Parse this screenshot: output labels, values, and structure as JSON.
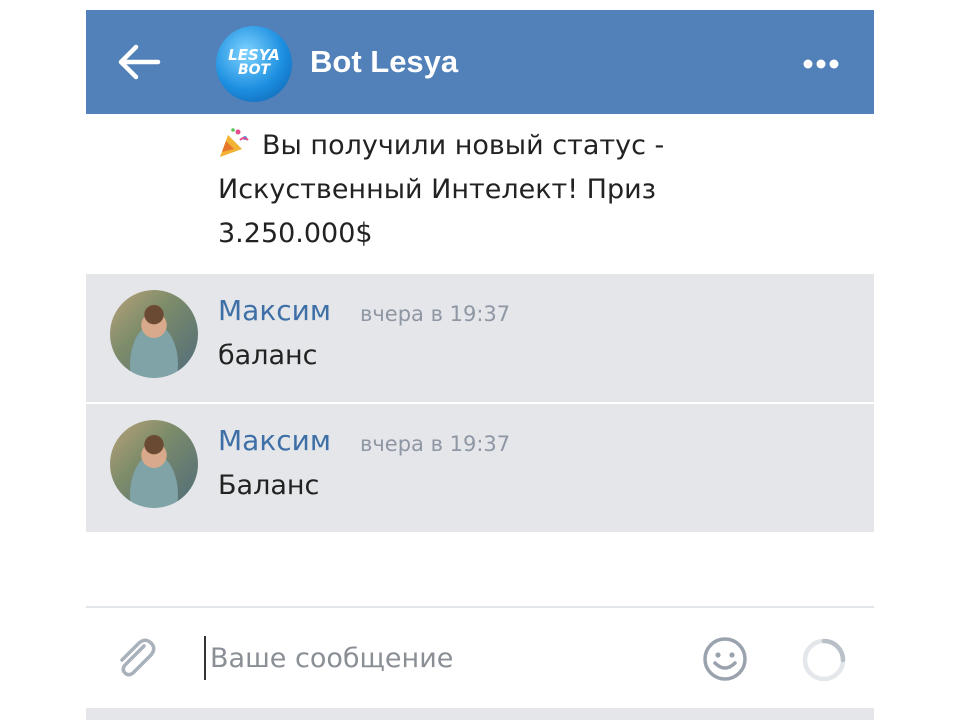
{
  "header": {
    "back_icon": "arrow-left-icon",
    "bot_logo_line1": "LESYA",
    "bot_logo_line2": "BOT",
    "bot_name": "Bot Lesya",
    "more_icon": "more-horizontal-icon",
    "background": "#5181b8"
  },
  "messages": {
    "first": {
      "icon": "party-popper-icon",
      "line1": "Вы получили новый статус -",
      "line2": "Искуственный Интелект! Приз",
      "line3": "3.250.000$"
    },
    "items": [
      {
        "sender": "Максим",
        "time": "вчера в 19:37",
        "text": "баланс"
      },
      {
        "sender": "Максим",
        "time": "вчера в 19:37",
        "text": "Баланс"
      }
    ]
  },
  "composer": {
    "attach_icon": "paperclip-icon",
    "placeholder": "Ваше сообщение",
    "emoji_icon": "smiley-icon",
    "send_icon": "loading-spinner-icon"
  },
  "colors": {
    "accent": "#5181b8",
    "sender_name": "#3e6fa6",
    "timestamp": "#8e97a3",
    "selected_row": "#e4e6ea"
  }
}
